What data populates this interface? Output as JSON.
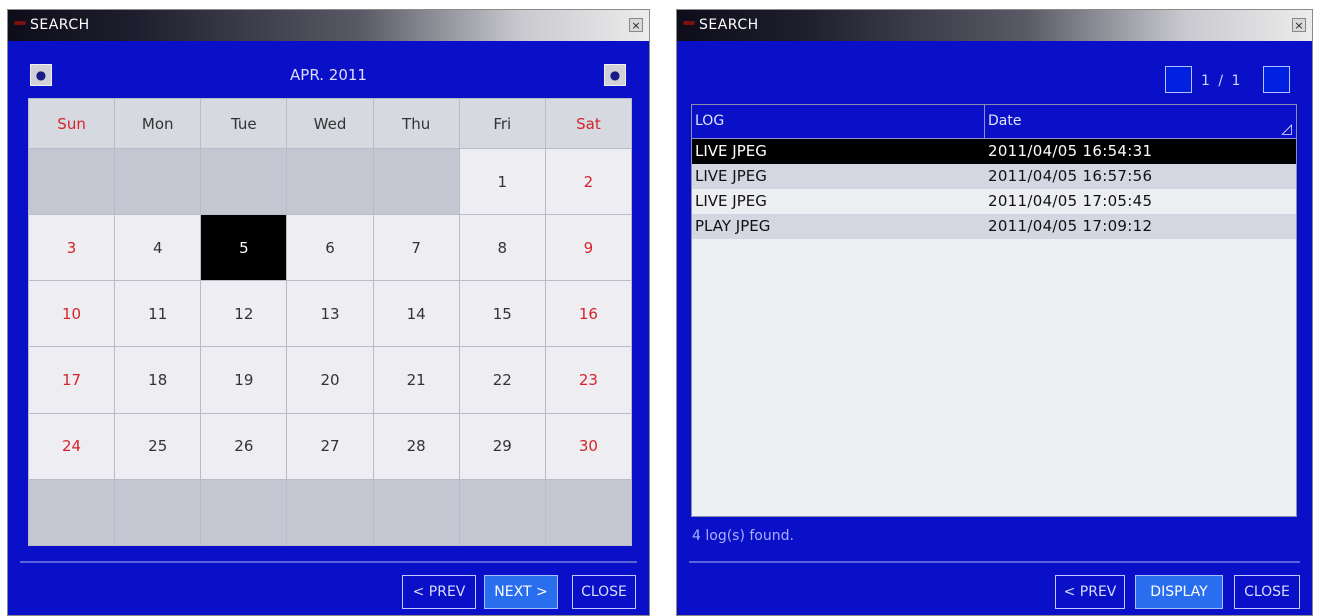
{
  "calendar_window": {
    "title": "SEARCH",
    "close_glyph": "×",
    "month_label": "APR. 2011",
    "prev_glyph": "●",
    "next_glyph": "●",
    "weekdays": [
      "Sun",
      "Mon",
      "Tue",
      "Wed",
      "Thu",
      "Fri",
      "Sat"
    ],
    "weeks": [
      [
        "",
        "",
        "",
        "",
        "",
        "1",
        "2"
      ],
      [
        "3",
        "4",
        "5",
        "6",
        "7",
        "8",
        "9"
      ],
      [
        "10",
        "11",
        "12",
        "13",
        "14",
        "15",
        "16"
      ],
      [
        "17",
        "18",
        "19",
        "20",
        "21",
        "22",
        "23"
      ],
      [
        "24",
        "25",
        "26",
        "27",
        "28",
        "29",
        "30"
      ],
      [
        "",
        "",
        "",
        "",
        "",
        "",
        ""
      ]
    ],
    "selected_day": "5",
    "buttons": {
      "prev": "< PREV",
      "next": "NEXT >",
      "close": "CLOSE"
    }
  },
  "log_window": {
    "title": "SEARCH",
    "close_glyph": "×",
    "pager": "1 / 1",
    "columns": {
      "log": "LOG",
      "date": "Date"
    },
    "sort_glyph": "◿",
    "rows": [
      {
        "log": "LIVE JPEG",
        "date": "2011/04/05 16:54:31"
      },
      {
        "log": "LIVE JPEG",
        "date": "2011/04/05 16:57:56"
      },
      {
        "log": "LIVE JPEG",
        "date": "2011/04/05 17:05:45"
      },
      {
        "log": "PLAY JPEG",
        "date": "2011/04/05 17:09:12"
      }
    ],
    "found_text": "4 log(s) found.",
    "buttons": {
      "prev": "< PREV",
      "display": "DISPLAY",
      "close": "CLOSE"
    }
  },
  "colors": {
    "window_bg": "#0a10c8",
    "weekend": "#d4242a",
    "selected_row": "#000000",
    "active_button": "#2a6ef0"
  }
}
